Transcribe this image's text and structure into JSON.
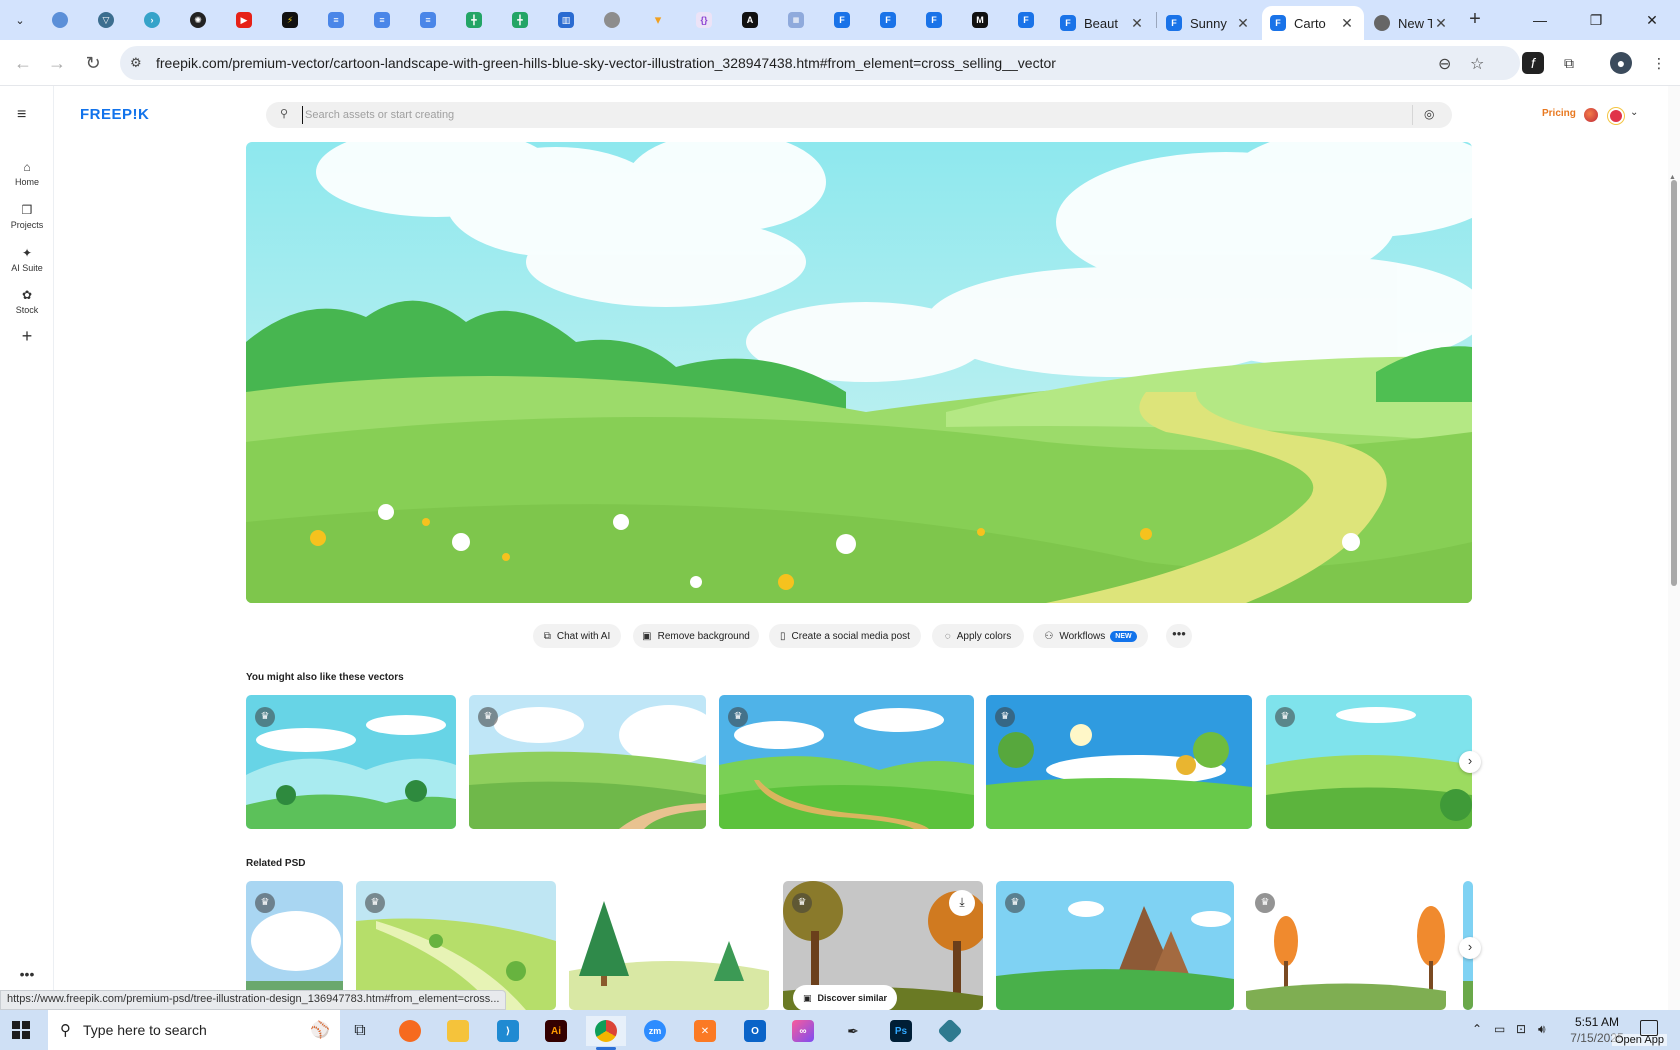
{
  "browser": {
    "tabs": [
      {
        "title": "Beaut",
        "favicon": "doc-icon",
        "active": false
      },
      {
        "title": "Sunny",
        "favicon": "doc-icon",
        "active": false
      },
      {
        "title": "Carto",
        "favicon": "doc-icon",
        "active": true
      },
      {
        "title": "New T",
        "favicon": "chrome-icon",
        "active": false
      }
    ],
    "url": "freepik.com/premium-vector/cartoon-landscape-with-green-hills-blue-sky-vector-illustration_328947438.htm#from_element=cross_selling__vector",
    "status_url": "https://www.freepik.com/premium-psd/tree-illustration-design_136947783.htm#from_element=cross..."
  },
  "freepik": {
    "logo": "FREEP!K",
    "search_placeholder": "Search assets or start creating",
    "pricing": "Pricing",
    "sidebar": [
      {
        "label": "Home",
        "icon": "home-icon"
      },
      {
        "label": "Projects",
        "icon": "projects-icon"
      },
      {
        "label": "AI Suite",
        "icon": "ai-suite-icon"
      },
      {
        "label": "Stock",
        "icon": "stock-icon"
      }
    ],
    "actions": [
      {
        "label": "Chat with AI",
        "icon": "chat-icon"
      },
      {
        "label": "Remove background",
        "icon": "remove-bg-icon"
      },
      {
        "label": "Create a social media post",
        "icon": "phone-icon"
      },
      {
        "label": "Apply colors",
        "icon": "palette-icon"
      },
      {
        "label": "Workflows",
        "icon": "workflow-icon",
        "badge": "NEW"
      }
    ],
    "sections": {
      "vectors_title": "You might also like these vectors",
      "psd_title": "Related PSD"
    },
    "discover_similar": "Discover similar"
  },
  "taskbar": {
    "search_text": "Type here to search",
    "time": "5:51 AM",
    "date": "7/15/2025",
    "open_app": "Open App"
  },
  "colors": {
    "brand": "#1273eb",
    "pricing": "#e8781f",
    "sky": "#8fe6ef",
    "grass": "#8fd156"
  }
}
